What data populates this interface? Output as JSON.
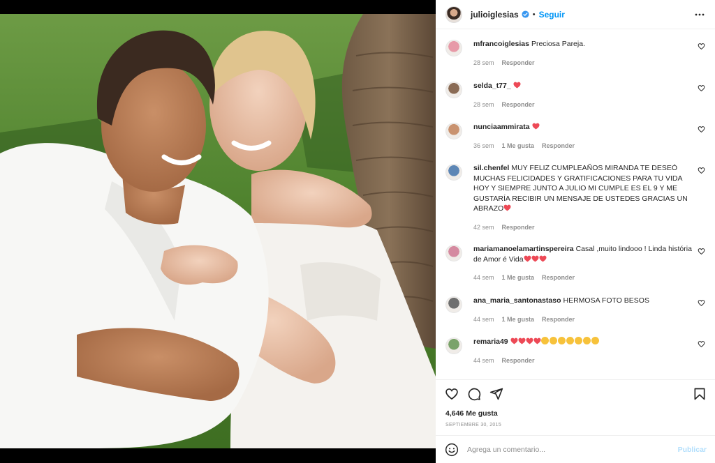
{
  "post": {
    "username": "julioiglesias",
    "dot": "•",
    "follow_label": "Seguir",
    "likes": "4,646 Me gusta",
    "date": "SEPTIEMBRE 30, 2015",
    "comment_placeholder": "Agrega un comentario...",
    "publish_label": "Publicar"
  },
  "comments": [
    {
      "user": "mfrancoiglesias",
      "text": "Preciosa Pareja.",
      "hearts": 0,
      "clap_emojis": 0,
      "time": "28 sem",
      "likes": "",
      "reply": "Responder",
      "avatar_color": "#e79aa8"
    },
    {
      "user": "selda_t77_",
      "text": "",
      "hearts": 1,
      "clap_emojis": 0,
      "time": "28 sem",
      "likes": "",
      "reply": "Responder",
      "avatar_color": "#8a6b55"
    },
    {
      "user": "nunciaammirata",
      "text": "",
      "hearts": 1,
      "clap_emojis": 0,
      "time": "36 sem",
      "likes": "1 Me gusta",
      "reply": "Responder",
      "avatar_color": "#c9926f"
    },
    {
      "user": "sil.chenfel",
      "text": "MUY FELIZ CUMPLEAÑOS MIRANDA TE DESEÓ MUCHAS FELICIDADES Y GRATIFICACIONES PARA TU VIDA HOY Y SIEMPRE JUNTO A JULIO MI CUMPLE ES EL 9 Y ME GUSTARÍA RECIBIR UN MENSAJE DE USTEDES GRACIAS UN ABRAZO",
      "hearts": 1,
      "clap_emojis": 0,
      "time": "42 sem",
      "likes": "",
      "reply": "Responder",
      "avatar_color": "#5d86b5"
    },
    {
      "user": "mariamanoelamartinspereira",
      "text": "Casal ,muito lindooo ! Linda história de Amor é Vida",
      "hearts": 3,
      "clap_emojis": 0,
      "time": "44 sem",
      "likes": "1 Me gusta",
      "reply": "Responder",
      "avatar_color": "#d58aa0"
    },
    {
      "user": "ana_maria_santonastaso",
      "text": "HERMOSA FOTO BESOS",
      "hearts": 0,
      "clap_emojis": 0,
      "time": "44 sem",
      "likes": "1 Me gusta",
      "reply": "Responder",
      "avatar_color": "#6f6f6f"
    },
    {
      "user": "remaria49",
      "text": "",
      "hearts": 4,
      "clap_emojis": 7,
      "time": "44 sem",
      "likes": "",
      "reply": "Responder",
      "avatar_color": "#7aa36a"
    }
  ],
  "icons": {
    "verified": "verified-badge-icon",
    "more": "more-options-icon",
    "like": "heart-outline-icon",
    "comment": "comment-icon",
    "share": "paper-plane-icon",
    "save": "bookmark-icon",
    "emoji": "smiley-icon"
  },
  "colors": {
    "accent": "#0095f6",
    "verified": "#3897f0",
    "red_heart": "#ed4956",
    "muted": "#8e8e8e",
    "publish_disabled": "#b2dffc"
  }
}
